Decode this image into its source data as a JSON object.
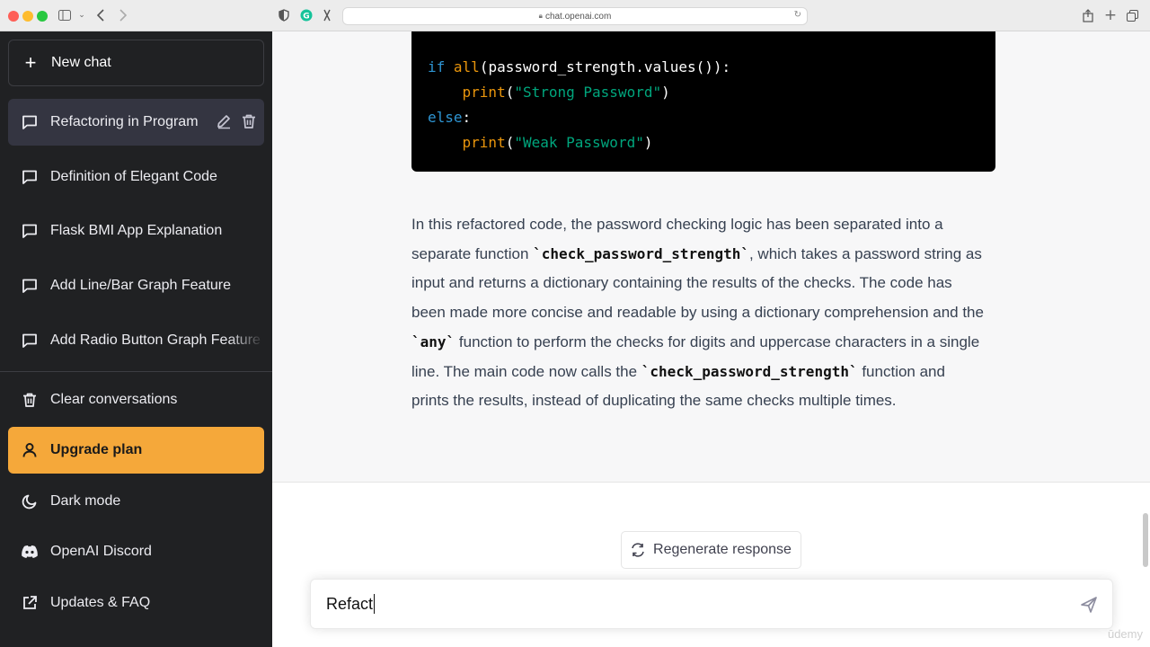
{
  "browser": {
    "url": "chat.openai.com"
  },
  "sidebar": {
    "new_chat": "New chat",
    "conversations": [
      {
        "label": "Refactoring in Program",
        "active": true
      },
      {
        "label": "Definition of Elegant Code"
      },
      {
        "label": "Flask BMI App Explanation"
      },
      {
        "label": "Add Line/Bar Graph Feature"
      },
      {
        "label": "Add Radio Button Graph Feature"
      }
    ],
    "menu": {
      "clear": "Clear conversations",
      "upgrade": "Upgrade plan",
      "dark_mode": "Dark mode",
      "discord": "OpenAI Discord",
      "faq": "Updates & FAQ"
    }
  },
  "code": {
    "line1_kw": "if",
    "line1_fn": "all",
    "line1_rest": "(password_strength.values()):",
    "line2_fn": "print",
    "line2_open": "(",
    "line2_str": "\"Strong Password\"",
    "line2_close": ")",
    "line3_kw": "else",
    "line3_rest": ":",
    "line4_fn": "print",
    "line4_open": "(",
    "line4_str": "\"Weak Password\"",
    "line4_close": ")"
  },
  "response": {
    "p1": "In this refactored code, the password checking logic has been separated into a separate function ",
    "c1": "`check_password_strength`",
    "p2": ", which takes a password string as input and returns a dictionary containing the results of the checks. The code has been made more concise and readable by using a dictionary comprehension and the ",
    "c2": "`any`",
    "p3": " function to perform the checks for digits and uppercase characters in a single line. The main code now calls the ",
    "c3": "`check_password_strength`",
    "p4": " function and prints the results, instead of duplicating the same checks multiple times."
  },
  "composer": {
    "regenerate": "Regenerate response",
    "input_value": "Refact"
  },
  "watermark": "ūdemy",
  "colors": {
    "sidebar_bg": "#202123",
    "upgrade_bg": "#f5a83a",
    "code_bg": "#000000"
  }
}
